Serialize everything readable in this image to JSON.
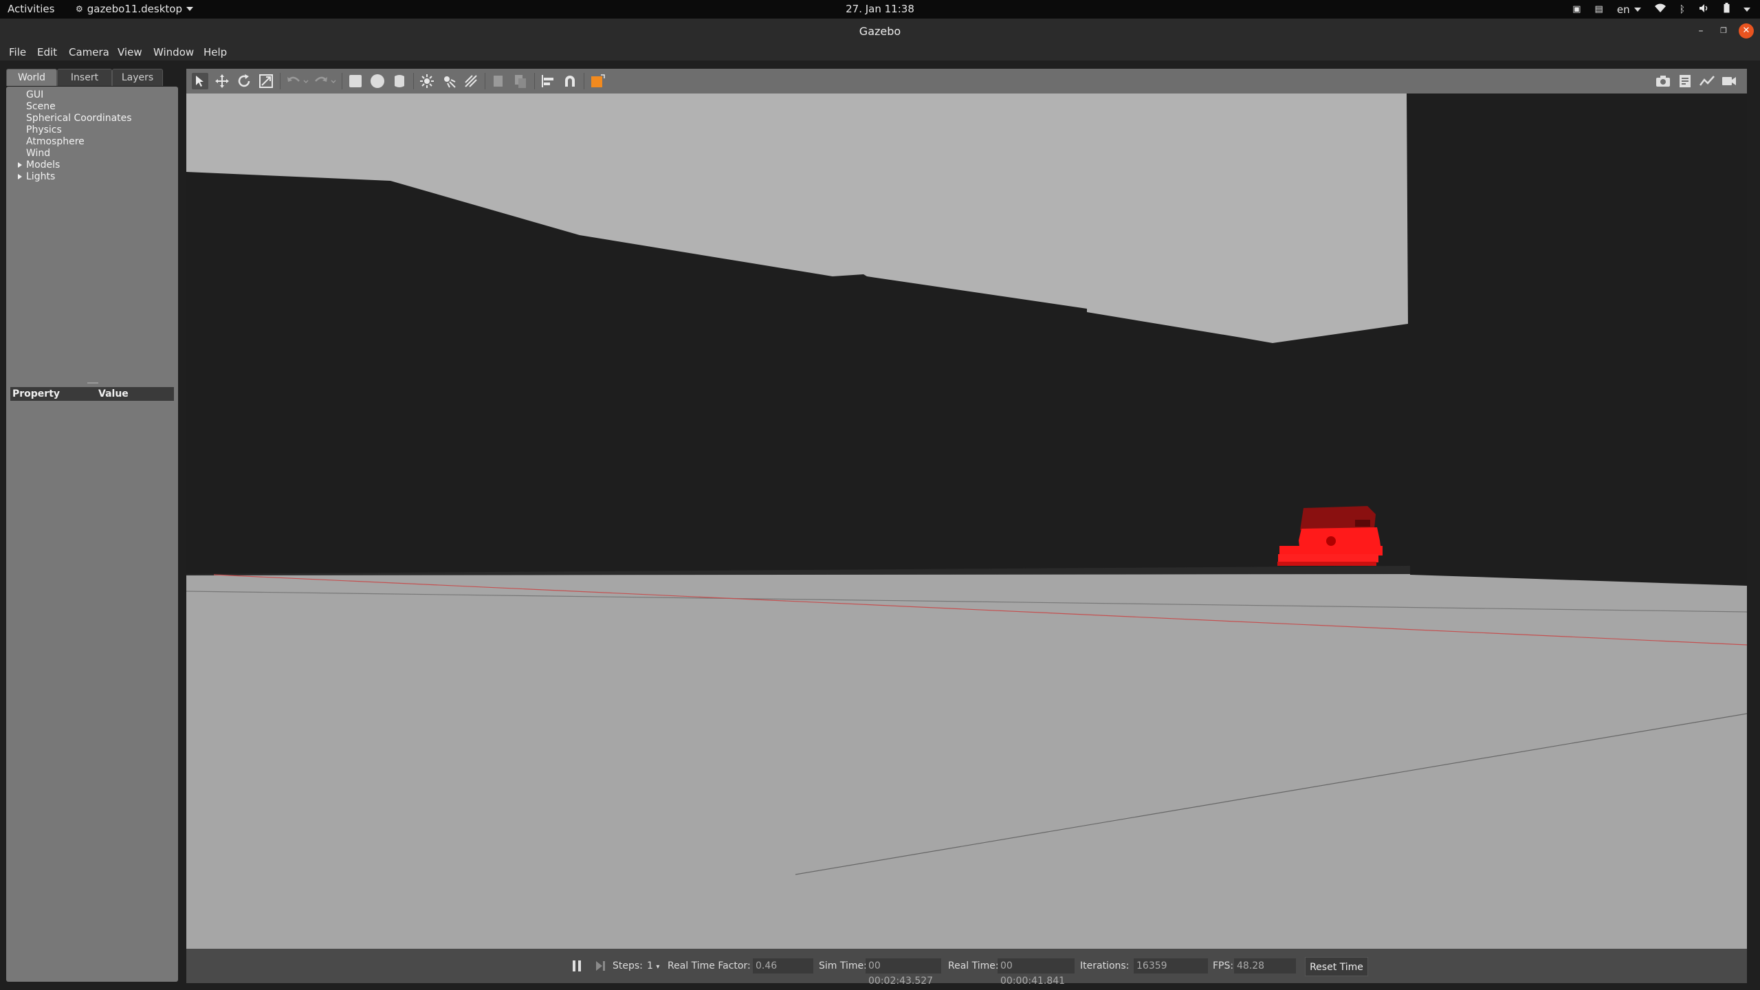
{
  "topbar": {
    "activities": "Activities",
    "app_name": "gazebo11.desktop",
    "clock": "27. Jan 11:38",
    "language": "en"
  },
  "window": {
    "title": "Gazebo"
  },
  "menubar": {
    "items": [
      "File",
      "Edit",
      "Camera",
      "View",
      "Window",
      "Help"
    ]
  },
  "left_panel": {
    "tabs": [
      "World",
      "Insert",
      "Layers"
    ],
    "active_tab": "World",
    "tree": [
      "GUI",
      "Scene",
      "Spherical Coordinates",
      "Physics",
      "Atmosphere",
      "Wind",
      "Models",
      "Lights"
    ],
    "property_header": {
      "property": "Property",
      "value": "Value"
    }
  },
  "toolbar": {
    "left_icons": [
      "select-arrow-icon",
      "translate-icon",
      "rotate-icon",
      "scale-icon",
      "undo-icon",
      "redo-icon",
      "box-icon",
      "sphere-icon",
      "cylinder-icon",
      "point-light-icon",
      "spot-light-icon",
      "directional-light-icon",
      "copy-icon",
      "paste-icon",
      "align-icon",
      "snap-icon",
      "view-angle-icon"
    ],
    "right_icons": [
      "screenshot-icon",
      "log-icon",
      "plot-icon",
      "record-video-icon"
    ]
  },
  "status": {
    "steps_label": "Steps:",
    "steps_value": "1",
    "rtf_label": "Real Time Factor:",
    "rtf_value": "0.46",
    "sim_time_label": "Sim Time:",
    "sim_time_value": "00 00:02:43.527",
    "real_time_label": "Real Time:",
    "real_time_value": "00 00:00:41.841",
    "iterations_label": "Iterations:",
    "iterations_value": "16359",
    "fps_label": "FPS:",
    "fps_value": "48.28",
    "reset_label": "Reset Time"
  },
  "colors": {
    "accent": "#e95420",
    "robot": "#ff1a1a",
    "ground": "#a6a6a6",
    "sky_wall": "#b3b3b3"
  }
}
